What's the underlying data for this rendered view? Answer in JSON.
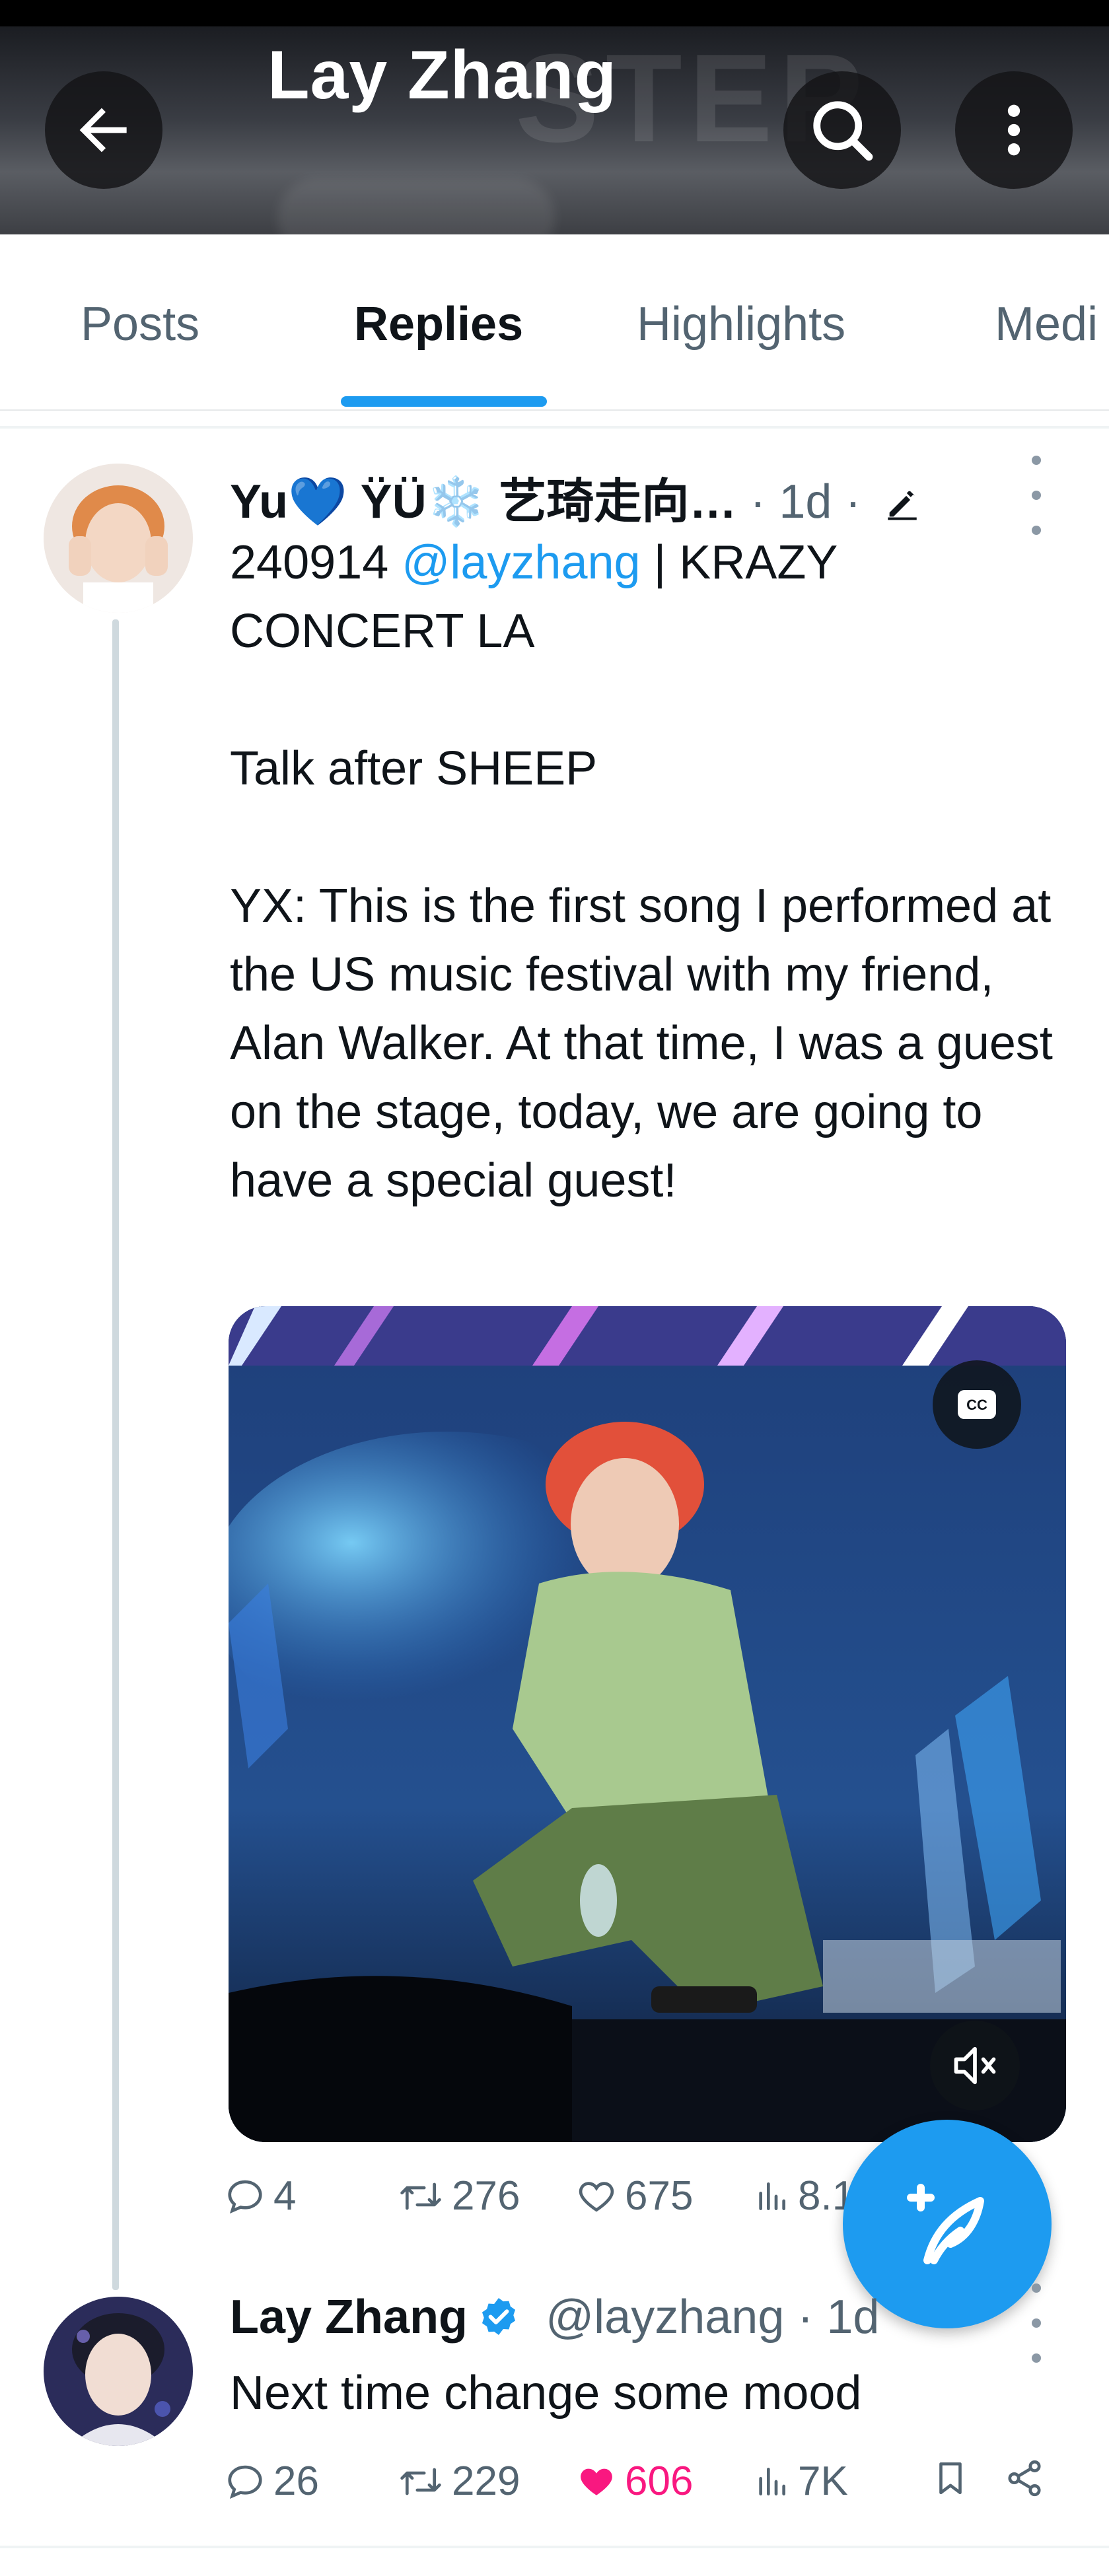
{
  "header": {
    "title": "Lay Zhang",
    "back_icon": "arrow-left-icon",
    "search_icon": "search-icon",
    "more_icon": "more-vertical-icon"
  },
  "tabs": [
    {
      "label": "Posts"
    },
    {
      "label": "Replies"
    },
    {
      "label": "Highlights"
    },
    {
      "label": "Medi"
    }
  ],
  "tweets": [
    {
      "display_name": "Yu💙 ŸÜ❄️ 艺琦走向…",
      "time": "· 1d ·",
      "edited_icon": "pencil-icon",
      "text_line1_prefix": "240914 ",
      "mention": "@layzhang",
      "text_line1_suffix": " | KRAZY",
      "text_line2": "CONCERT LA",
      "text_para2": "Talk after SHEEP",
      "text_para3": "YX: This is the first song I performed at the US music festival with my friend, Alan Walker. At that time, I was a guest on the stage, today, we are going to have a special guest!",
      "media": {
        "cc_icon": "closed-captions-icon",
        "mute_icon": "volume-muted-icon"
      },
      "stats": {
        "replies": "4",
        "reposts": "276",
        "likes": "675",
        "views": "8.1"
      }
    },
    {
      "display_name": "Lay Zhang",
      "handle": "@layzhang",
      "time": "· 1d",
      "text": "Next time change some mood",
      "stats": {
        "replies": "26",
        "reposts": "229",
        "likes": "606",
        "views": "7K"
      }
    }
  ],
  "colors": {
    "accent": "#1d9bf0",
    "like": "#f91880",
    "muted": "#536471",
    "text": "#0f1419"
  },
  "fab_icon": "compose-feather-plus-icon"
}
